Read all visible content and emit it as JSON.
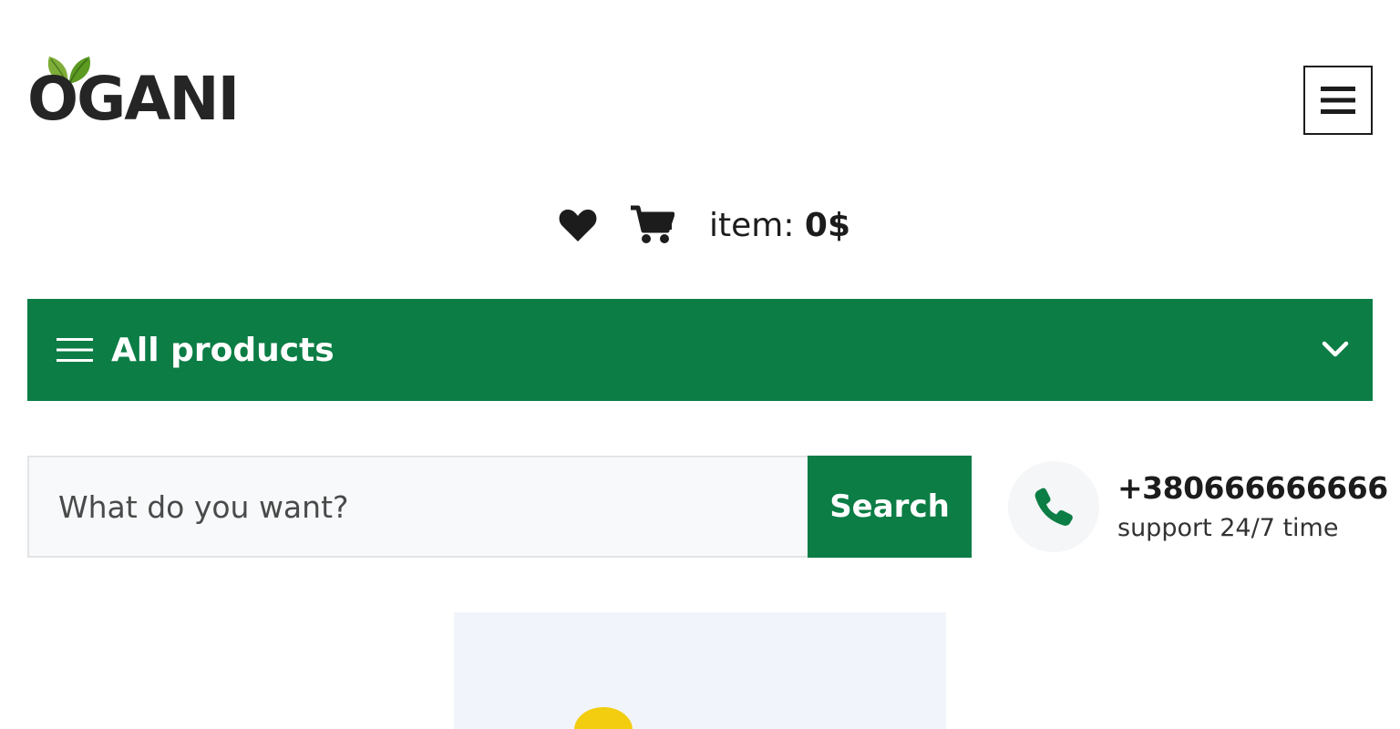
{
  "brand": {
    "logo_text": "OGANI"
  },
  "header": {
    "cart_label": "item:",
    "cart_value": "0$"
  },
  "categories": {
    "label": "All products"
  },
  "search": {
    "placeholder": "What do you want?",
    "button_label": "Search"
  },
  "contact": {
    "phone": "+380666666666",
    "support_text": "support 24/7 time"
  },
  "colors": {
    "primary_green": "#0b7d45",
    "leaf_green": "#7fad39",
    "text_dark": "#1c1c1c"
  },
  "icons": {
    "hamburger": "hamburger-menu-icon",
    "wishlist": "heart-icon",
    "cart": "shopping-cart-icon",
    "categories": "bars-icon",
    "dropdown": "chevron-down-icon",
    "phone": "phone-icon"
  }
}
